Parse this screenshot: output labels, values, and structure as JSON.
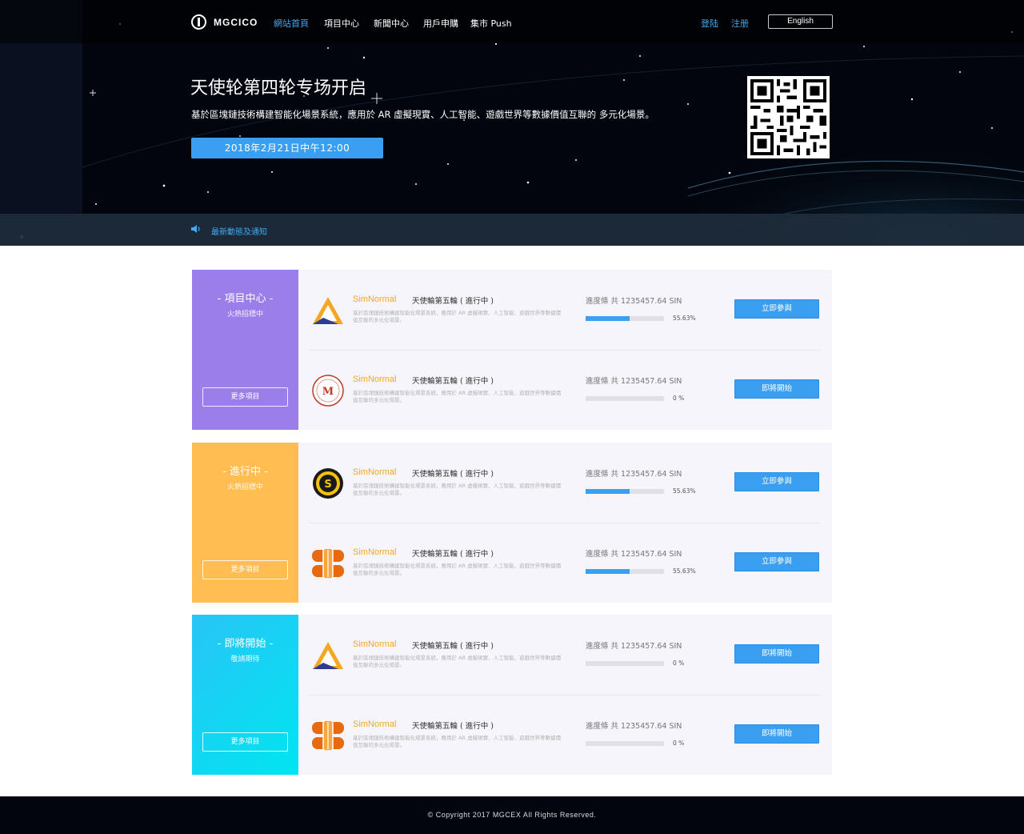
{
  "nav": {
    "logo_text": "MGCICO",
    "items": [
      {
        "label": "網站首頁",
        "active": true
      },
      {
        "label": "項目中心",
        "active": false
      },
      {
        "label": "新聞中心",
        "active": false
      },
      {
        "label": "用戶申購",
        "active": false
      },
      {
        "label": "集市 Push",
        "active": false
      }
    ],
    "login": "登陆",
    "register": "注册",
    "language": "English"
  },
  "hero": {
    "title": "天使轮第四轮专场开启",
    "subtitle": "基於區塊鏈技術構建智能化場景系統，應用於 AR 虛擬現實、人工智能、遊戲世界等數據價值互聯的 多元化場景。",
    "date_button": "2018年2月21日中午12:00",
    "notice": "最新動態及通知"
  },
  "groups": [
    {
      "title": "- 項目中心 -",
      "subtitle": "火熱招標中",
      "more": "更多項目",
      "items": [
        {
          "logo": "triangle-logo",
          "brand": "SimNormal",
          "title": "天使輪第五輪 ( 進行中 )",
          "desc": "基於區塊鏈技術構建智能化場景系統，應用於 AR 虛擬現實、人工智能、遊戲世界等數據價值互聯的多元化場景。",
          "progress_label": "進度條  共 1235457.64  SIN",
          "progress": 55.63,
          "percent": "55.63%",
          "cta": "立即參與"
        },
        {
          "logo": "seal-m-logo",
          "brand": "SimNormal",
          "title": "天使輪第五輪 ( 進行中 )",
          "desc": "基於區塊鏈技術構建智能化場景系統，應用於 AR 虛擬現實、人工智能、遊戲世界等數據價值互聯的多元化場景。",
          "progress_label": "進度條  共 1235457.64  SIN",
          "progress": 0,
          "percent": "0 %",
          "cta": "即將開始"
        }
      ]
    },
    {
      "title": "- 進行中 -",
      "subtitle": "火熱招標中",
      "more": "更多項目",
      "items": [
        {
          "logo": "coin-s-logo",
          "brand": "SimNormal",
          "title": "天使輪第五輪 ( 進行中 )",
          "desc": "基於區塊鏈技術構建智能化場景系統，應用於 AR 虛擬現實、人工智能、遊戲世界等數據價值互聯的多元化場景。",
          "progress_label": "進度條  共 1235457.64  SIN",
          "progress": 55.63,
          "percent": "55.63%",
          "cta": "立即參與"
        },
        {
          "logo": "orange-emblem-logo",
          "brand": "SimNormal",
          "title": "天使輪第五輪 ( 進行中 )",
          "desc": "基於區塊鏈技術構建智能化場景系統，應用於 AR 虛擬現實、人工智能、遊戲世界等數據價值互聯的多元化場景。",
          "progress_label": "進度條  共 1235457.64  SIN",
          "progress": 55.63,
          "percent": "55.63%",
          "cta": "立即參與"
        }
      ]
    },
    {
      "title": "- 即將開始 -",
      "subtitle": "敬請期待",
      "more": "更多項目",
      "items": [
        {
          "logo": "triangle-logo",
          "brand": "SimNormal",
          "title": "天使輪第五輪 ( 進行中 )",
          "desc": "基於區塊鏈技術構建智能化場景系統，應用於 AR 虛擬現實、人工智能、遊戲世界等數據價值互聯的多元化場景。",
          "progress_label": "進度條  共 1235457.64  SIN",
          "progress": 0,
          "percent": "0 %",
          "cta": "即將開始"
        },
        {
          "logo": "orange-emblem-logo",
          "brand": "SimNormal",
          "title": "天使輪第五輪 ( 進行中 )",
          "desc": "基於區塊鏈技術構建智能化場景系統，應用於 AR 虛擬現實、人工智能、遊戲世界等數據價值互聯的多元化場景。",
          "progress_label": "進度條  共 1235457.64  SIN",
          "progress": 0,
          "percent": "0 %",
          "cta": "即將開始"
        }
      ]
    }
  ],
  "footer": {
    "copyright": "© Copyright 2017 MGCEX All Rights Reserved."
  },
  "colors": {
    "accent": "#3a9ff0",
    "brand_text": "#f5a623",
    "purple": "#9b7ee9",
    "yellow": "#ffbd52",
    "cyan": "#00e5f0"
  }
}
